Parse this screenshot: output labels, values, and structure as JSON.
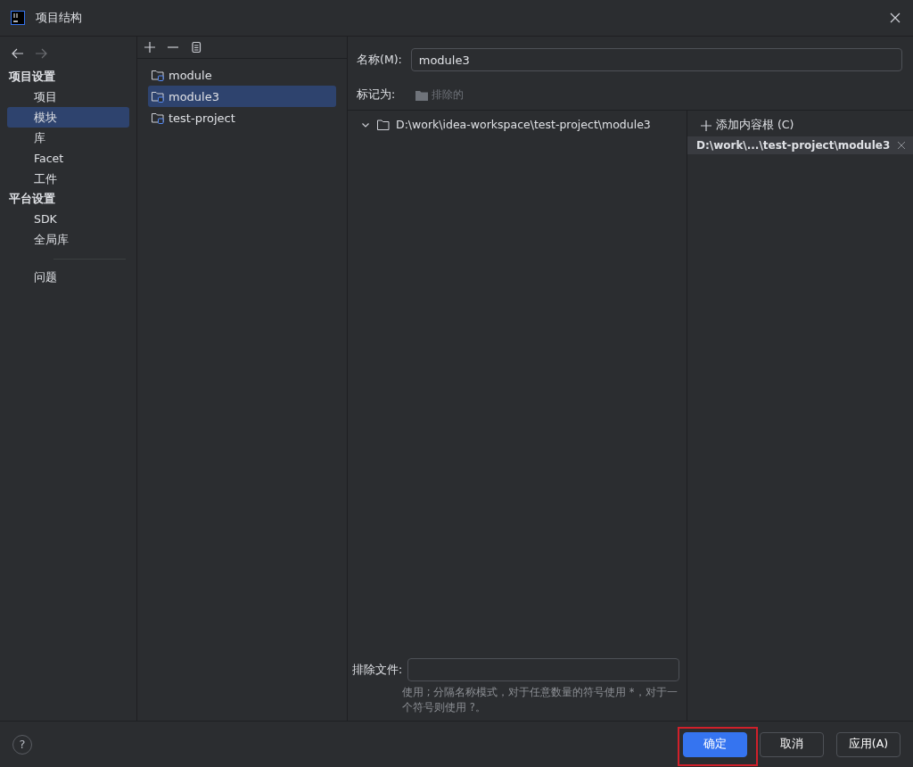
{
  "window": {
    "title": "项目结构"
  },
  "sidebar": {
    "nav": [
      {
        "kind": "back",
        "disabled": false
      },
      {
        "kind": "forward",
        "disabled": true
      }
    ],
    "sections": [
      {
        "title": "项目设置",
        "items": [
          {
            "label": "项目",
            "selected": false
          },
          {
            "label": "模块",
            "selected": true
          },
          {
            "label": "库",
            "selected": false
          },
          {
            "label": "Facet",
            "selected": false
          },
          {
            "label": "工件",
            "selected": false
          }
        ]
      },
      {
        "title": "平台设置",
        "items": [
          {
            "label": "SDK",
            "selected": false
          },
          {
            "label": "全局库",
            "selected": false
          }
        ]
      }
    ],
    "extra_items": [
      {
        "label": "问题",
        "selected": false
      }
    ]
  },
  "modules": {
    "toolbar": [
      {
        "kind": "add"
      },
      {
        "kind": "remove"
      },
      {
        "kind": "copy"
      }
    ],
    "items": [
      {
        "label": "module",
        "selected": false
      },
      {
        "label": "module3",
        "selected": true
      },
      {
        "label": "test-project",
        "selected": false
      }
    ]
  },
  "details": {
    "name": {
      "label": "名称(M):",
      "value": "module3"
    },
    "mark_as": {
      "label": "标记为:",
      "options": [
        {
          "label": "排除的",
          "disabled": true
        }
      ]
    },
    "tree": {
      "label": "D:\\work\\idea-workspace\\test-project\\module3",
      "expanded": true
    },
    "content_roots": {
      "add_label": "添加内容根 (C)",
      "roots": [
        {
          "label": "D:\\work\\...\\test-project\\module3",
          "selected": true
        }
      ]
    },
    "exclude": {
      "label": "排除文件:",
      "hint": "使用 ; 分隔名称模式，对于任意数量的符号使用 *，对于一个符号则使用 ?。"
    }
  },
  "footer": {
    "help": "?",
    "buttons": [
      {
        "label": "确定",
        "kind": "primary",
        "highlighted": true
      },
      {
        "label": "取消",
        "kind": "secondary",
        "highlighted": false
      },
      {
        "label": "应用(A)",
        "kind": "secondary",
        "highlighted": false
      }
    ]
  }
}
